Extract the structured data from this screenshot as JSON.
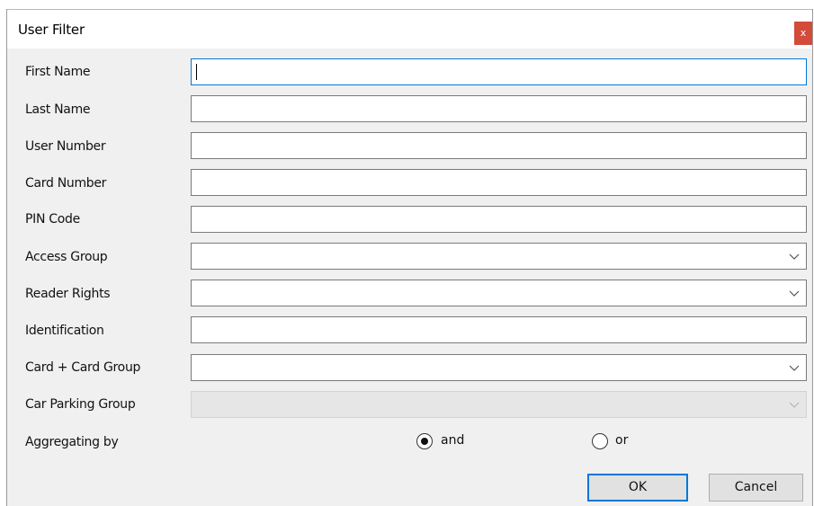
{
  "window": {
    "title": "User Filter",
    "close_label": "x"
  },
  "fields": {
    "first_name": {
      "label": "First Name",
      "value": ""
    },
    "last_name": {
      "label": "Last Name",
      "value": ""
    },
    "user_number": {
      "label": "User Number",
      "value": ""
    },
    "card_number": {
      "label": "Card Number",
      "value": ""
    },
    "pin_code": {
      "label": "PIN Code",
      "value": ""
    },
    "access_group": {
      "label": "Access Group",
      "value": ""
    },
    "reader_rights": {
      "label": "Reader Rights",
      "value": ""
    },
    "identification": {
      "label": "Identification",
      "value": ""
    },
    "card_card_group": {
      "label": "Card + Card Group",
      "value": ""
    },
    "car_parking_group": {
      "label": "Car Parking Group",
      "value": "",
      "disabled": true
    }
  },
  "aggregating": {
    "label": "Aggregating by",
    "options": [
      "and",
      "or"
    ],
    "selected": "and"
  },
  "buttons": {
    "ok": "OK",
    "cancel": "Cancel"
  },
  "colors": {
    "focus_border": "#0078d7",
    "close_button": "#d24b3b",
    "dialog_background": "#f0f0f0"
  }
}
